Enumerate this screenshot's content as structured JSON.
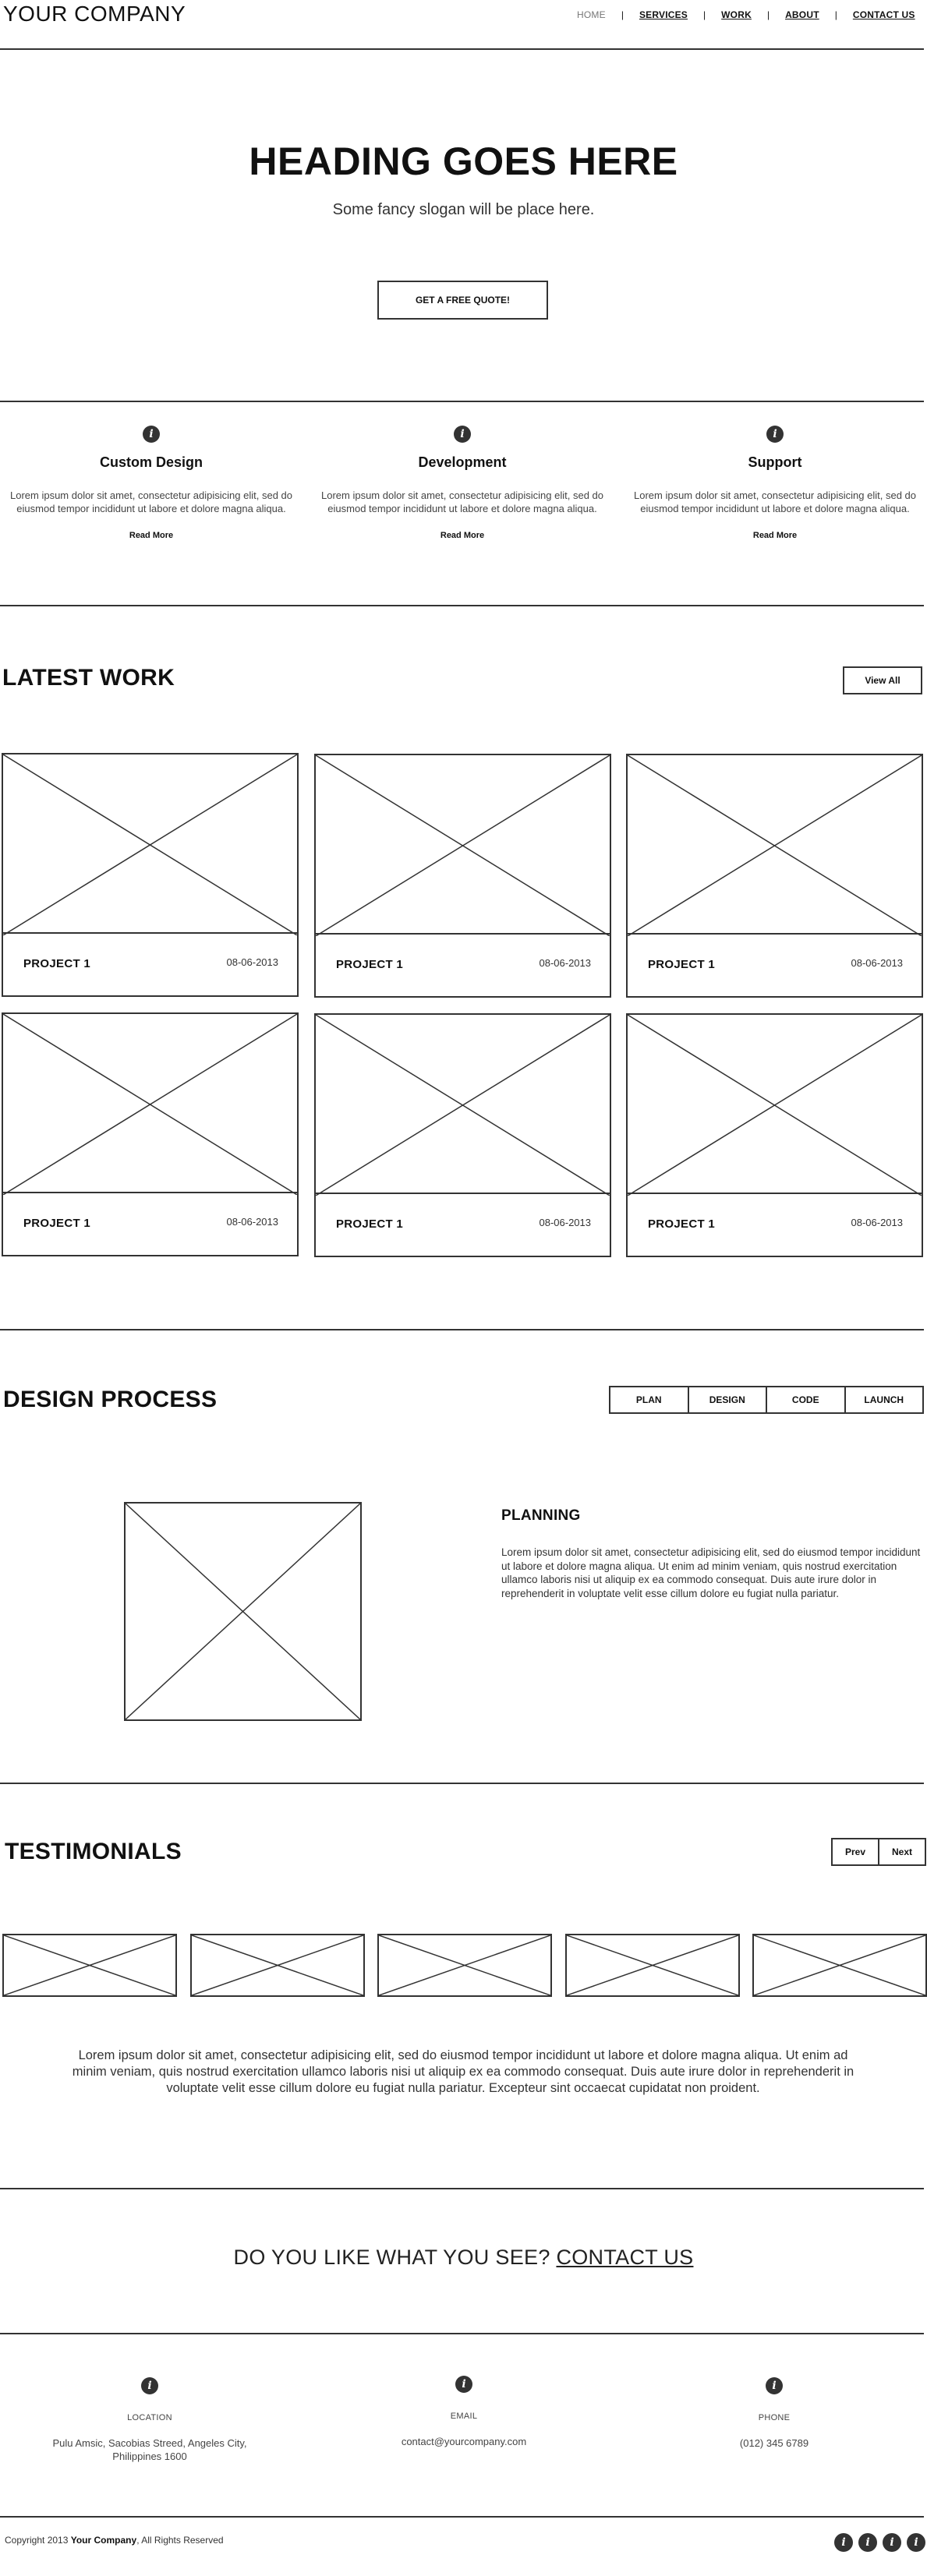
{
  "header": {
    "logo": "YOUR COMPANY",
    "nav": [
      "HOME",
      "SERVICES",
      "WORK",
      "ABOUT",
      "CONTACT US"
    ],
    "separator": "|"
  },
  "hero": {
    "title": "HEADING GOES HERE",
    "slogan": "Some fancy slogan will be place here.",
    "button": "GET A FREE QUOTE!"
  },
  "features": [
    {
      "icon": "info-icon",
      "title": "Custom Design",
      "text": "Lorem ipsum dolor sit amet, consectetur adipisicing elit, sed do eiusmod tempor incididunt ut labore et dolore magna aliqua.",
      "link": "Read More"
    },
    {
      "icon": "info-icon",
      "title": "Development",
      "text": "Lorem ipsum dolor sit amet, consectetur adipisicing elit, sed do eiusmod tempor incididunt ut labore et dolore magna aliqua.",
      "link": "Read More"
    },
    {
      "icon": "info-icon",
      "title": "Support",
      "text": "Lorem ipsum dolor sit amet, consectetur adipisicing elit, sed do eiusmod tempor incididunt ut labore et dolore magna aliqua.",
      "link": "Read More"
    }
  ],
  "latest_work": {
    "title": "LATEST WORK",
    "view_all": "View All",
    "projects": [
      {
        "name": "PROJECT 1",
        "date": "08-06-2013"
      },
      {
        "name": "PROJECT 1",
        "date": "08-06-2013"
      },
      {
        "name": "PROJECT 1",
        "date": "08-06-2013"
      },
      {
        "name": "PROJECT 1",
        "date": "08-06-2013"
      },
      {
        "name": "PROJECT 1",
        "date": "08-06-2013"
      },
      {
        "name": "PROJECT 1",
        "date": "08-06-2013"
      }
    ]
  },
  "design_process": {
    "title": "DESIGN PROCESS",
    "tabs": [
      "PLAN",
      "DESIGN",
      "CODE",
      "LAUNCH"
    ],
    "panel_title": "PLANNING",
    "panel_text": "Lorem ipsum dolor sit amet, consectetur adipisicing elit, sed do eiusmod tempor incididunt ut labore et dolore magna aliqua.  Ut enim ad minim veniam, quis nostrud exercitation ullamco laboris nisi ut aliquip ex ea commodo consequat. Duis aute irure dolor in reprehenderit in voluptate velit esse cillum dolore eu fugiat nulla pariatur."
  },
  "testimonials": {
    "title": "TESTIMONIALS",
    "prev": "Prev",
    "next": "Next",
    "text": "Lorem ipsum dolor sit amet, consectetur adipisicing elit, sed do eiusmod tempor incididunt ut labore et dolore magna aliqua. Ut enim ad minim veniam, quis nostrud exercitation ullamco laboris nisi ut aliquip ex ea commodo consequat. Duis aute irure dolor in reprehenderit in voluptate velit esse cillum dolore eu fugiat nulla pariatur. Excepteur sint occaecat cupidatat non proident."
  },
  "cta": {
    "text": "DO YOU LIKE WHAT YOU SEE?",
    "link": "CONTACT US"
  },
  "contact": [
    {
      "icon": "info-icon",
      "label": "LOCATION",
      "value": "Pulu Amsic, Sacobias Streed, Angeles City, Philippines 1600"
    },
    {
      "icon": "info-icon",
      "label": "EMAIL",
      "value": "contact@yourcompany.com"
    },
    {
      "icon": "info-icon",
      "label": "PHONE",
      "value": "(012) 345 6789"
    }
  ],
  "footer": {
    "copyright_prefix": "Copyright 2013",
    "company": "Your Company",
    "copyright_suffix": ", All Rights Reserved",
    "social_icons": [
      "info-icon",
      "info-icon",
      "info-icon",
      "info-icon"
    ]
  },
  "colors": {
    "line": "#333333",
    "text": "#111111",
    "muted": "#444444"
  }
}
